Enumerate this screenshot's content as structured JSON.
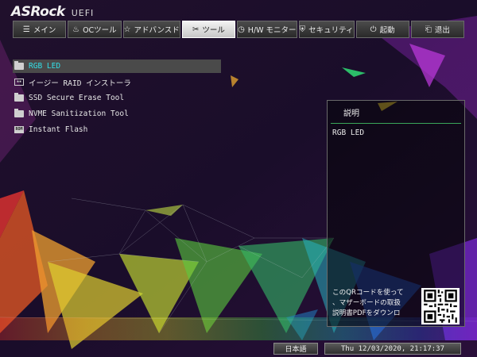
{
  "header": {
    "brand": "ASRock",
    "product": "UEFI"
  },
  "tabs": [
    {
      "label": "メイン",
      "icon": "list-icon",
      "glyph": "☰",
      "active": false
    },
    {
      "label": "OCツール",
      "icon": "flame-icon",
      "glyph": "♨",
      "active": false
    },
    {
      "label": "アドバンスド",
      "icon": "star-icon",
      "glyph": "☆",
      "active": false
    },
    {
      "label": "ツール",
      "icon": "tools-icon",
      "glyph": "✂",
      "active": true
    },
    {
      "label": "H/W モニター",
      "icon": "monitor-icon",
      "glyph": "◷",
      "active": false
    },
    {
      "label": "セキュリティ",
      "icon": "shield-icon",
      "glyph": "⛨",
      "active": false
    },
    {
      "label": "起動",
      "icon": "power-icon",
      "glyph": "⏻",
      "active": false
    },
    {
      "label": "退出",
      "icon": "exit-icon",
      "glyph": "⎗",
      "active": false
    }
  ],
  "menu": {
    "items": [
      {
        "label": "RGB LED",
        "icon": "folder-icon",
        "selected": true
      },
      {
        "label": "イージー RAID インストーラ",
        "icon": "raid-icon",
        "selected": false
      },
      {
        "label": "SSD Secure Erase Tool",
        "icon": "folder-icon",
        "selected": false
      },
      {
        "label": "NVME Sanitization Tool",
        "icon": "folder-icon",
        "selected": false
      },
      {
        "label": "Instant Flash",
        "icon": "rom-icon",
        "selected": false
      }
    ]
  },
  "panel": {
    "title": "説明",
    "description": "RGB LED",
    "qr_line1": "このQRコードを使って",
    "qr_line2": "、マザーボードの取扱",
    "qr_line3": "説明書PDFをダウンロ"
  },
  "footer": {
    "language": "日本語",
    "datetime": "Thu 12/03/2020, 21:17:37"
  },
  "colors": {
    "selected_text": "#33e0e8",
    "selected_bg": "#4a4a4a",
    "panel_rule": "#3aa65a",
    "background": "#1e0f2e"
  }
}
